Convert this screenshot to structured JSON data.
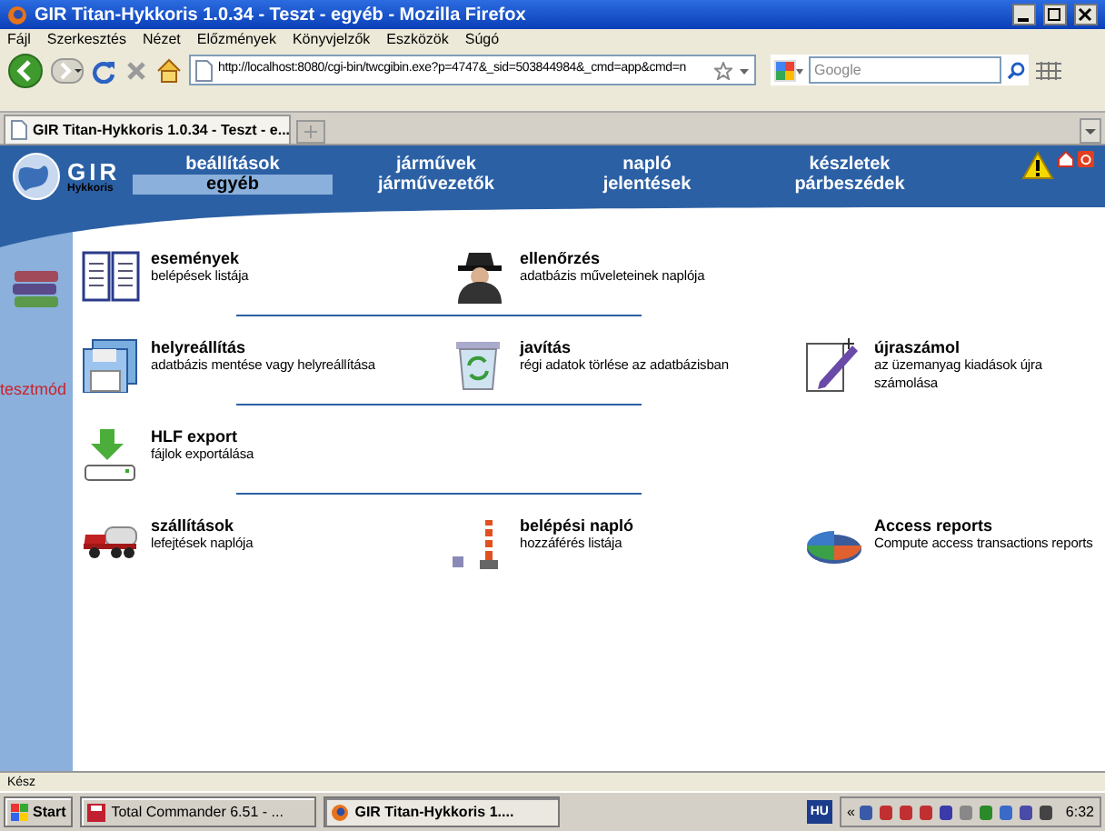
{
  "window": {
    "title": "GIR Titan-Hykkoris 1.0.34 - Teszt - egyéb - Mozilla Firefox"
  },
  "menu": [
    "Fájl",
    "Szerkesztés",
    "Nézet",
    "Előzmények",
    "Könyvjelzők",
    "Eszközök",
    "Súgó"
  ],
  "address_bar": {
    "value": "http://localhost:8080/cgi-bin/twcgibin.exe?p=4747&_sid=503844984&_cmd=app&cmd=n"
  },
  "search": {
    "placeholder": "Google"
  },
  "tabs": [
    {
      "label": "GIR Titan-Hykkoris 1.0.34 - Teszt - e...",
      "selected": true
    }
  ],
  "app": {
    "logo": "GIR",
    "logo_subtitle": "Hykkoris",
    "nav": [
      {
        "label": "beállítások",
        "selected": false
      },
      {
        "label": "egyéb",
        "selected": true
      },
      {
        "label": "járművek",
        "selected": false
      },
      {
        "label": "járművezetők",
        "selected": false
      },
      {
        "label": "napló",
        "selected": false
      },
      {
        "label": "jelentések",
        "selected": false
      },
      {
        "label": "készletek",
        "selected": false
      },
      {
        "label": "párbeszédek",
        "selected": false
      }
    ],
    "sidebar_label": "tesztmód",
    "rows": [
      [
        {
          "kind": "events",
          "title": "események",
          "subtitle": "belépések listája"
        },
        {
          "kind": "spy",
          "title": "ellenőrzés",
          "subtitle": "adatbázis műveleteinek naplója"
        }
      ],
      [
        {
          "kind": "floppy",
          "title": "helyreállítás",
          "subtitle": "adatbázis mentése vagy helyreállítása"
        },
        {
          "kind": "bin",
          "title": "javítás",
          "subtitle": "régi adatok törlése az adatbázisban"
        },
        {
          "kind": "pen",
          "title": "újraszámol",
          "subtitle": "az üzemanyag kiadások újra számolása"
        }
      ],
      [
        {
          "kind": "export",
          "title": "HLF export",
          "subtitle": "fájlok exportálása"
        }
      ],
      [
        {
          "kind": "truck",
          "title": "szállítások",
          "subtitle": "lefejtések naplója"
        },
        {
          "kind": "barrier",
          "title": "belépési napló",
          "subtitle": "hozzáférés listája"
        },
        {
          "kind": "pie",
          "title": "Access reports",
          "subtitle": "Compute access transactions reports"
        }
      ]
    ]
  },
  "status_bar": "Kész",
  "taskbar": {
    "start": "Start",
    "tasks": [
      {
        "label": "Total Commander 6.51 - ...",
        "selected": false
      },
      {
        "label": "GIR Titan-Hykkoris 1....",
        "selected": true
      }
    ],
    "language": "HU",
    "chevron": "«",
    "clock": "6:32"
  }
}
